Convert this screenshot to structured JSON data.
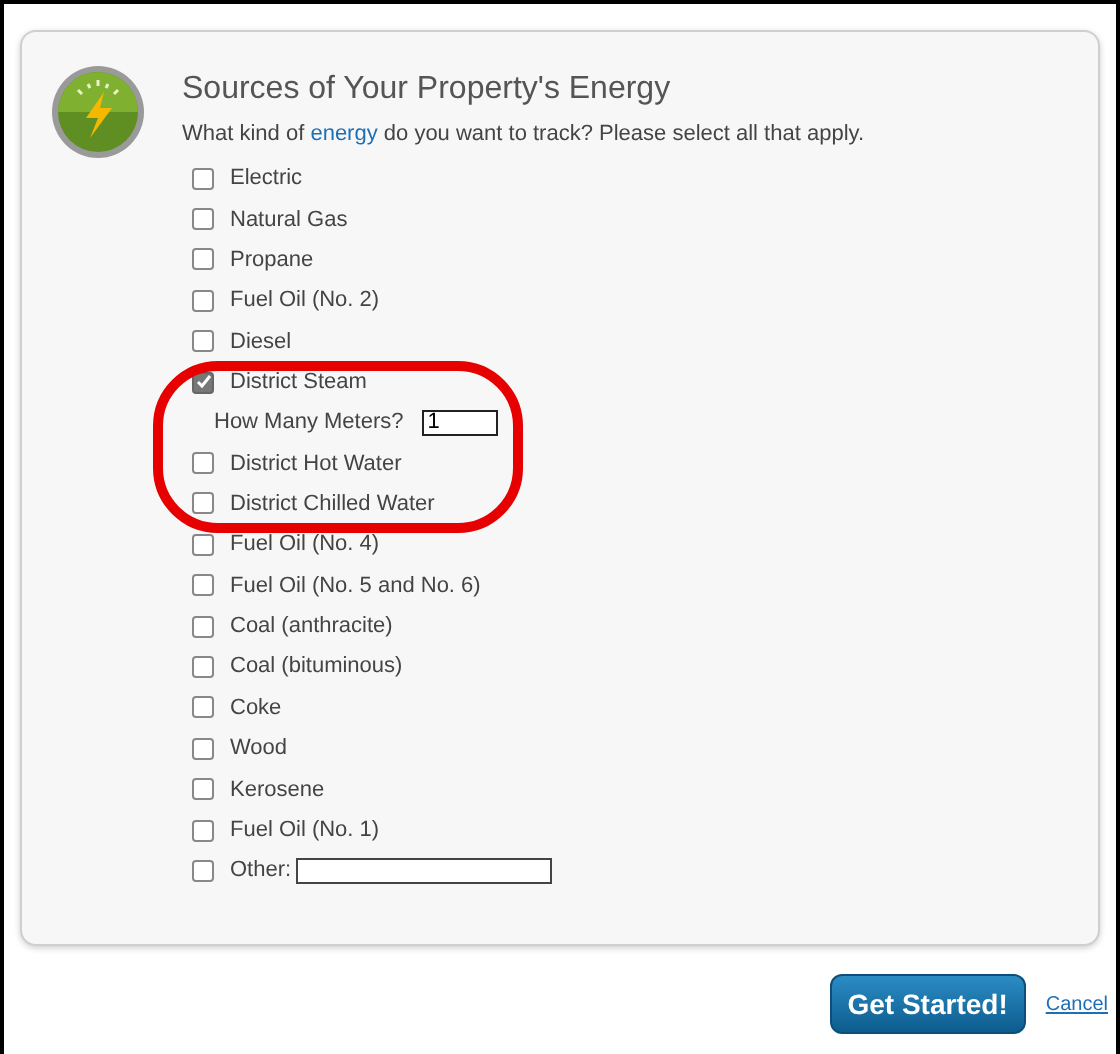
{
  "panel": {
    "title": "Sources of Your Property's Energy",
    "question": {
      "before": "What kind of ",
      "link": "energy",
      "after": " do you want to track? Please select all that apply."
    },
    "sources": [
      {
        "label": "Electric",
        "checked": false
      },
      {
        "label": "Natural Gas",
        "checked": false
      },
      {
        "label": "Propane",
        "checked": false
      },
      {
        "label": "Fuel Oil (No. 2)",
        "checked": false
      },
      {
        "label": "Diesel",
        "checked": false
      },
      {
        "label": "District Steam",
        "checked": true,
        "meters": {
          "label": "How Many Meters?",
          "value": "1"
        }
      },
      {
        "label": "District Hot Water",
        "checked": false
      },
      {
        "label": "District Chilled Water",
        "checked": false
      },
      {
        "label": "Fuel Oil (No. 4)",
        "checked": false
      },
      {
        "label": "Fuel Oil (No. 5 and No. 6)",
        "checked": false
      },
      {
        "label": "Coal (anthracite)",
        "checked": false
      },
      {
        "label": "Coal (bituminous)",
        "checked": false
      },
      {
        "label": "Coke",
        "checked": false
      },
      {
        "label": "Wood",
        "checked": false
      },
      {
        "label": "Kerosene",
        "checked": false
      },
      {
        "label": "Fuel Oil (No. 1)",
        "checked": false
      },
      {
        "label": "Other:",
        "checked": false,
        "kind": "other"
      }
    ]
  },
  "actions": {
    "primary": "Get Started!",
    "cancel": "Cancel"
  }
}
